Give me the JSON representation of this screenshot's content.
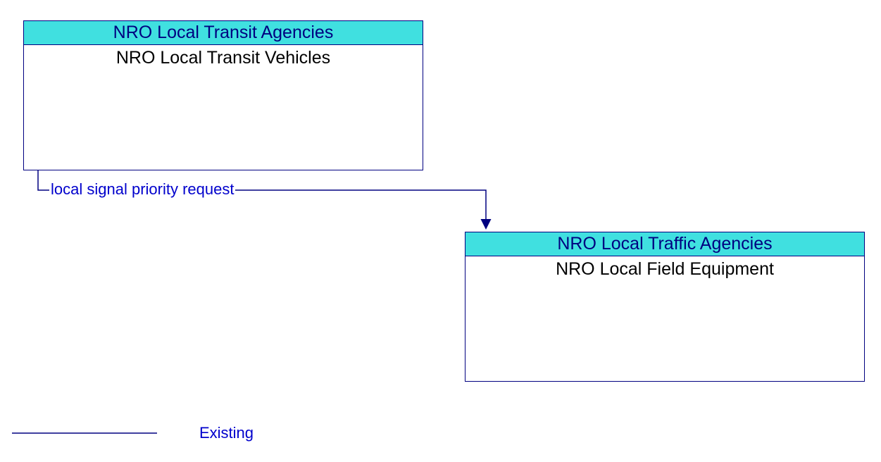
{
  "boxes": {
    "box1": {
      "header": "NRO Local Transit Agencies",
      "body": "NRO Local Transit Vehicles"
    },
    "box2": {
      "header": "NRO Local Traffic Agencies",
      "body": "NRO Local Field Equipment"
    }
  },
  "flows": {
    "flow1": "local signal priority request"
  },
  "legend": {
    "existing": "Existing"
  },
  "colors": {
    "header_bg": "#40E0E0",
    "border": "#000080",
    "line": "#000080",
    "label": "#0000cc"
  }
}
